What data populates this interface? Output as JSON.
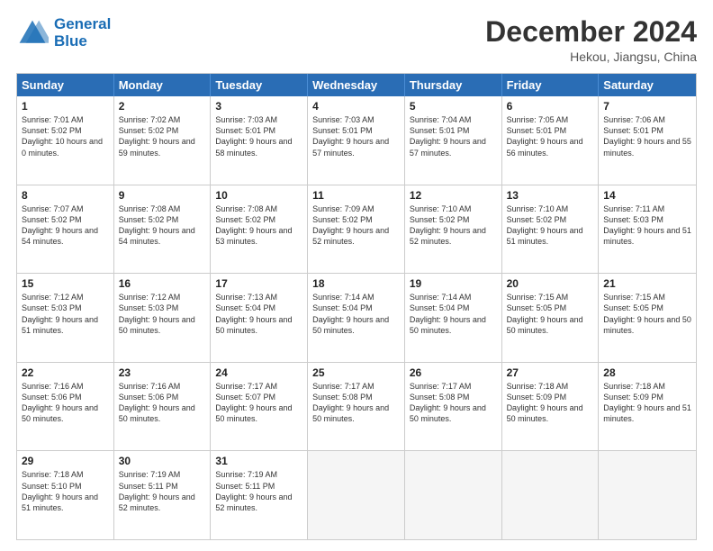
{
  "header": {
    "logo_line1": "General",
    "logo_line2": "Blue",
    "month_title": "December 2024",
    "location": "Hekou, Jiangsu, China"
  },
  "days_of_week": [
    "Sunday",
    "Monday",
    "Tuesday",
    "Wednesday",
    "Thursday",
    "Friday",
    "Saturday"
  ],
  "rows": [
    [
      {
        "day": "1",
        "sunrise": "Sunrise: 7:01 AM",
        "sunset": "Sunset: 5:02 PM",
        "daylight": "Daylight: 10 hours and 0 minutes."
      },
      {
        "day": "2",
        "sunrise": "Sunrise: 7:02 AM",
        "sunset": "Sunset: 5:02 PM",
        "daylight": "Daylight: 9 hours and 59 minutes."
      },
      {
        "day": "3",
        "sunrise": "Sunrise: 7:03 AM",
        "sunset": "Sunset: 5:01 PM",
        "daylight": "Daylight: 9 hours and 58 minutes."
      },
      {
        "day": "4",
        "sunrise": "Sunrise: 7:03 AM",
        "sunset": "Sunset: 5:01 PM",
        "daylight": "Daylight: 9 hours and 57 minutes."
      },
      {
        "day": "5",
        "sunrise": "Sunrise: 7:04 AM",
        "sunset": "Sunset: 5:01 PM",
        "daylight": "Daylight: 9 hours and 57 minutes."
      },
      {
        "day": "6",
        "sunrise": "Sunrise: 7:05 AM",
        "sunset": "Sunset: 5:01 PM",
        "daylight": "Daylight: 9 hours and 56 minutes."
      },
      {
        "day": "7",
        "sunrise": "Sunrise: 7:06 AM",
        "sunset": "Sunset: 5:01 PM",
        "daylight": "Daylight: 9 hours and 55 minutes."
      }
    ],
    [
      {
        "day": "8",
        "sunrise": "Sunrise: 7:07 AM",
        "sunset": "Sunset: 5:02 PM",
        "daylight": "Daylight: 9 hours and 54 minutes."
      },
      {
        "day": "9",
        "sunrise": "Sunrise: 7:08 AM",
        "sunset": "Sunset: 5:02 PM",
        "daylight": "Daylight: 9 hours and 54 minutes."
      },
      {
        "day": "10",
        "sunrise": "Sunrise: 7:08 AM",
        "sunset": "Sunset: 5:02 PM",
        "daylight": "Daylight: 9 hours and 53 minutes."
      },
      {
        "day": "11",
        "sunrise": "Sunrise: 7:09 AM",
        "sunset": "Sunset: 5:02 PM",
        "daylight": "Daylight: 9 hours and 52 minutes."
      },
      {
        "day": "12",
        "sunrise": "Sunrise: 7:10 AM",
        "sunset": "Sunset: 5:02 PM",
        "daylight": "Daylight: 9 hours and 52 minutes."
      },
      {
        "day": "13",
        "sunrise": "Sunrise: 7:10 AM",
        "sunset": "Sunset: 5:02 PM",
        "daylight": "Daylight: 9 hours and 51 minutes."
      },
      {
        "day": "14",
        "sunrise": "Sunrise: 7:11 AM",
        "sunset": "Sunset: 5:03 PM",
        "daylight": "Daylight: 9 hours and 51 minutes."
      }
    ],
    [
      {
        "day": "15",
        "sunrise": "Sunrise: 7:12 AM",
        "sunset": "Sunset: 5:03 PM",
        "daylight": "Daylight: 9 hours and 51 minutes."
      },
      {
        "day": "16",
        "sunrise": "Sunrise: 7:12 AM",
        "sunset": "Sunset: 5:03 PM",
        "daylight": "Daylight: 9 hours and 50 minutes."
      },
      {
        "day": "17",
        "sunrise": "Sunrise: 7:13 AM",
        "sunset": "Sunset: 5:04 PM",
        "daylight": "Daylight: 9 hours and 50 minutes."
      },
      {
        "day": "18",
        "sunrise": "Sunrise: 7:14 AM",
        "sunset": "Sunset: 5:04 PM",
        "daylight": "Daylight: 9 hours and 50 minutes."
      },
      {
        "day": "19",
        "sunrise": "Sunrise: 7:14 AM",
        "sunset": "Sunset: 5:04 PM",
        "daylight": "Daylight: 9 hours and 50 minutes."
      },
      {
        "day": "20",
        "sunrise": "Sunrise: 7:15 AM",
        "sunset": "Sunset: 5:05 PM",
        "daylight": "Daylight: 9 hours and 50 minutes."
      },
      {
        "day": "21",
        "sunrise": "Sunrise: 7:15 AM",
        "sunset": "Sunset: 5:05 PM",
        "daylight": "Daylight: 9 hours and 50 minutes."
      }
    ],
    [
      {
        "day": "22",
        "sunrise": "Sunrise: 7:16 AM",
        "sunset": "Sunset: 5:06 PM",
        "daylight": "Daylight: 9 hours and 50 minutes."
      },
      {
        "day": "23",
        "sunrise": "Sunrise: 7:16 AM",
        "sunset": "Sunset: 5:06 PM",
        "daylight": "Daylight: 9 hours and 50 minutes."
      },
      {
        "day": "24",
        "sunrise": "Sunrise: 7:17 AM",
        "sunset": "Sunset: 5:07 PM",
        "daylight": "Daylight: 9 hours and 50 minutes."
      },
      {
        "day": "25",
        "sunrise": "Sunrise: 7:17 AM",
        "sunset": "Sunset: 5:08 PM",
        "daylight": "Daylight: 9 hours and 50 minutes."
      },
      {
        "day": "26",
        "sunrise": "Sunrise: 7:17 AM",
        "sunset": "Sunset: 5:08 PM",
        "daylight": "Daylight: 9 hours and 50 minutes."
      },
      {
        "day": "27",
        "sunrise": "Sunrise: 7:18 AM",
        "sunset": "Sunset: 5:09 PM",
        "daylight": "Daylight: 9 hours and 50 minutes."
      },
      {
        "day": "28",
        "sunrise": "Sunrise: 7:18 AM",
        "sunset": "Sunset: 5:09 PM",
        "daylight": "Daylight: 9 hours and 51 minutes."
      }
    ],
    [
      {
        "day": "29",
        "sunrise": "Sunrise: 7:18 AM",
        "sunset": "Sunset: 5:10 PM",
        "daylight": "Daylight: 9 hours and 51 minutes."
      },
      {
        "day": "30",
        "sunrise": "Sunrise: 7:19 AM",
        "sunset": "Sunset: 5:11 PM",
        "daylight": "Daylight: 9 hours and 52 minutes."
      },
      {
        "day": "31",
        "sunrise": "Sunrise: 7:19 AM",
        "sunset": "Sunset: 5:11 PM",
        "daylight": "Daylight: 9 hours and 52 minutes."
      },
      null,
      null,
      null,
      null
    ]
  ]
}
